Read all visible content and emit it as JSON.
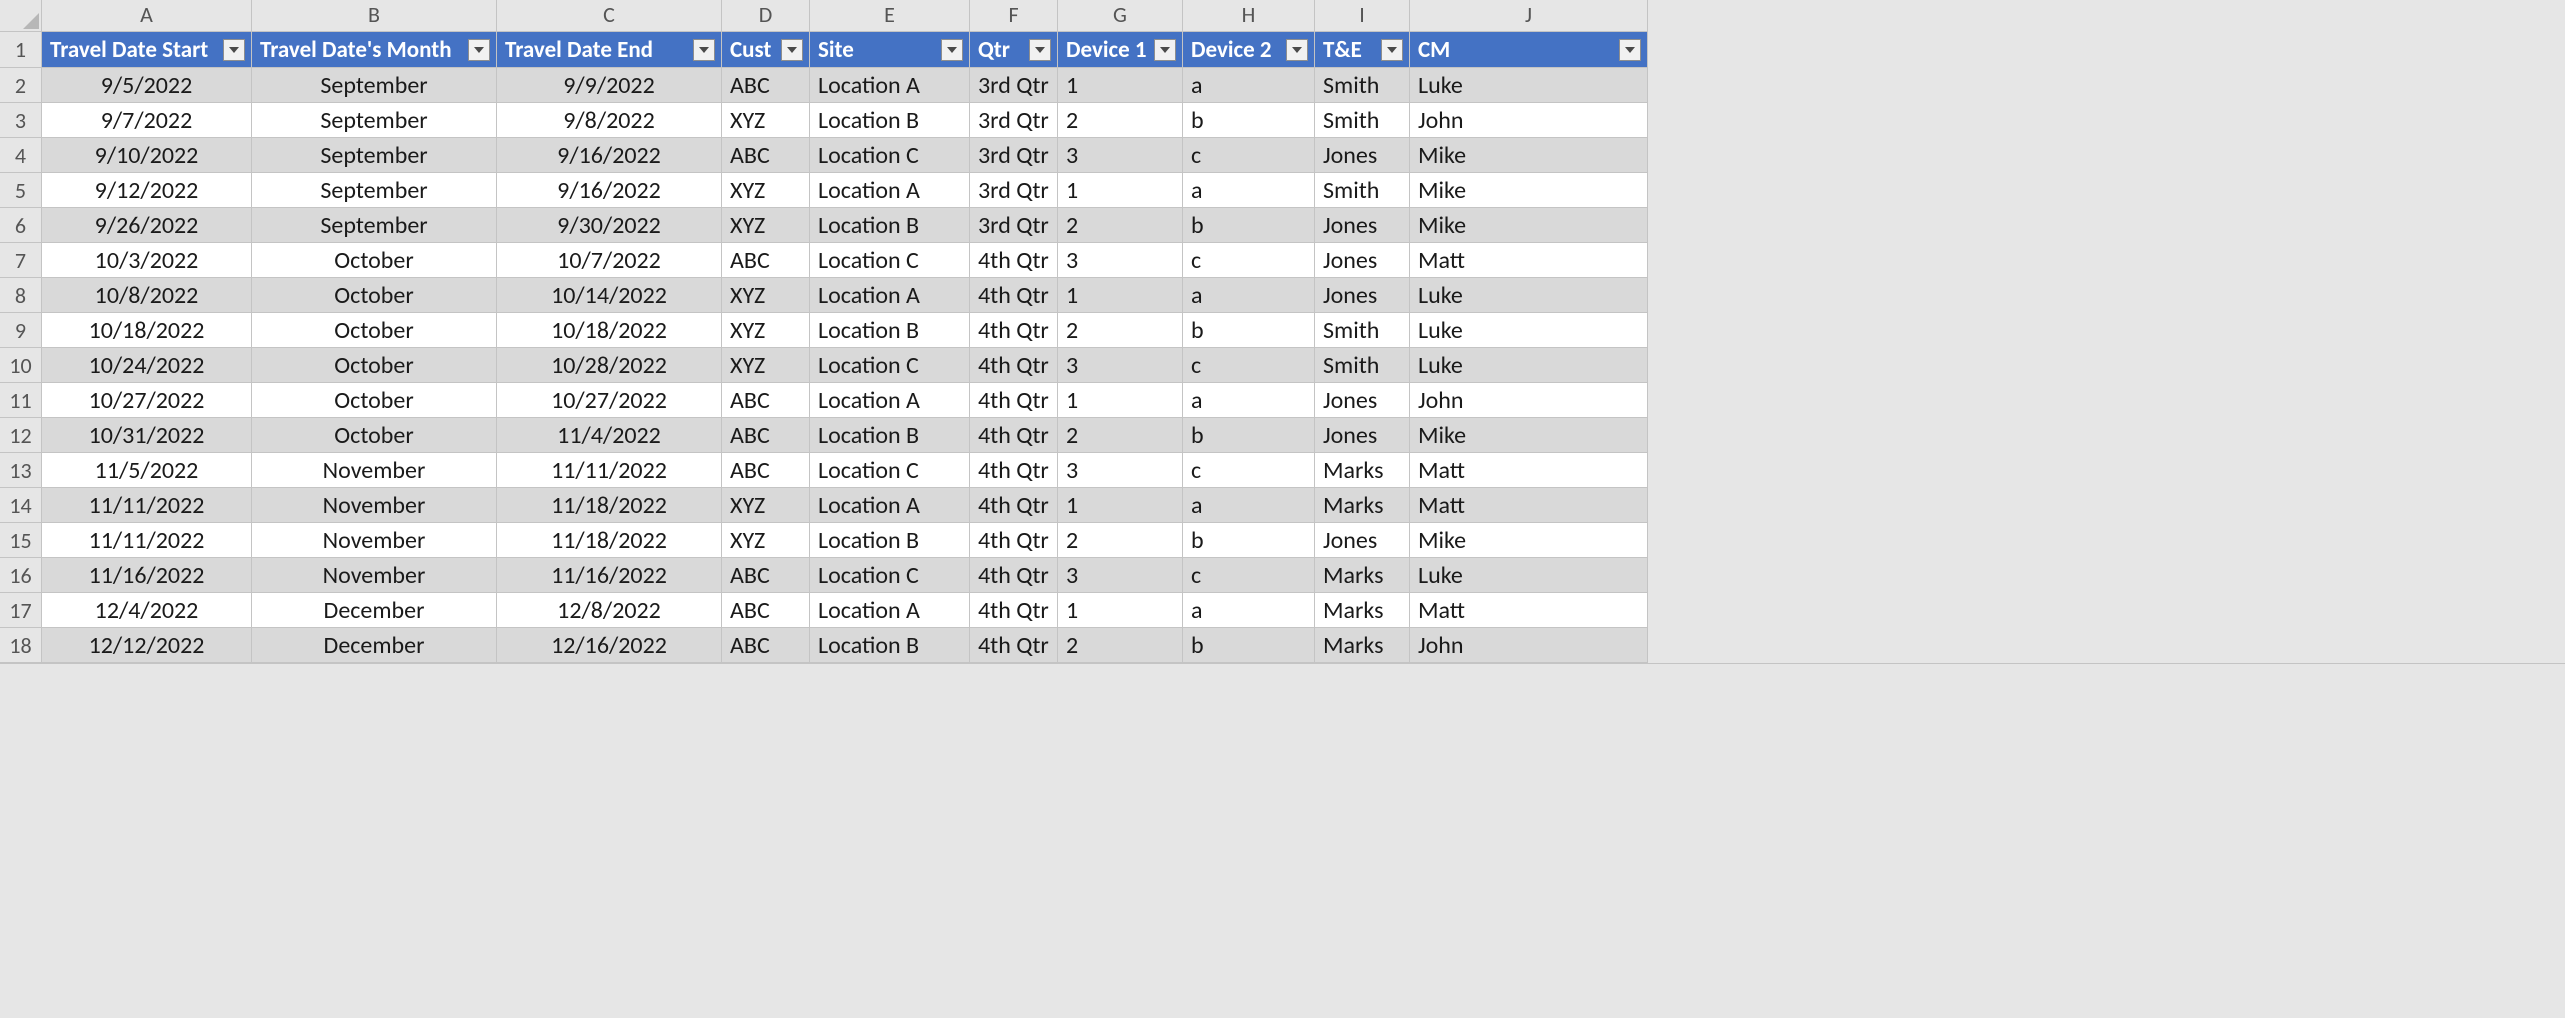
{
  "columns": [
    "A",
    "B",
    "C",
    "D",
    "E",
    "F",
    "G",
    "H",
    "I",
    "J"
  ],
  "header_row_number": "1",
  "headers": [
    "Travel Date Start",
    "Travel Date's Month",
    "Travel Date End",
    "Cust",
    "Site",
    "Qtr",
    "Device 1",
    "Device 2",
    "T&E",
    "CM"
  ],
  "col_align": [
    "center",
    "center",
    "center",
    "left",
    "left",
    "left",
    "left",
    "left",
    "left",
    "left"
  ],
  "row_numbers": [
    "2",
    "3",
    "4",
    "5",
    "6",
    "7",
    "8",
    "9",
    "10",
    "11",
    "12",
    "13",
    "14",
    "15",
    "16",
    "17",
    "18"
  ],
  "rows": [
    [
      "9/5/2022",
      "September",
      "9/9/2022",
      "ABC",
      "Location A",
      "3rd Qtr",
      "1",
      "a",
      "Smith",
      "Luke"
    ],
    [
      "9/7/2022",
      "September",
      "9/8/2022",
      "XYZ",
      "Location B",
      "3rd Qtr",
      "2",
      "b",
      "Smith",
      "John"
    ],
    [
      "9/10/2022",
      "September",
      "9/16/2022",
      "ABC",
      "Location C",
      "3rd Qtr",
      "3",
      "c",
      "Jones",
      "Mike"
    ],
    [
      "9/12/2022",
      "September",
      "9/16/2022",
      "XYZ",
      "Location A",
      "3rd Qtr",
      "1",
      "a",
      "Smith",
      "Mike"
    ],
    [
      "9/26/2022",
      "September",
      "9/30/2022",
      "XYZ",
      "Location B",
      "3rd Qtr",
      "2",
      "b",
      "Jones",
      "Mike"
    ],
    [
      "10/3/2022",
      "October",
      "10/7/2022",
      "ABC",
      "Location C",
      "4th Qtr",
      "3",
      "c",
      "Jones",
      "Matt"
    ],
    [
      "10/8/2022",
      "October",
      "10/14/2022",
      "XYZ",
      "Location A",
      "4th Qtr",
      "1",
      "a",
      "Jones",
      "Luke"
    ],
    [
      "10/18/2022",
      "October",
      "10/18/2022",
      "XYZ",
      "Location B",
      "4th Qtr",
      "2",
      "b",
      "Smith",
      "Luke"
    ],
    [
      "10/24/2022",
      "October",
      "10/28/2022",
      "XYZ",
      "Location C",
      "4th Qtr",
      "3",
      "c",
      "Smith",
      "Luke"
    ],
    [
      "10/27/2022",
      "October",
      "10/27/2022",
      "ABC",
      "Location A",
      "4th Qtr",
      "1",
      "a",
      "Jones",
      "John"
    ],
    [
      "10/31/2022",
      "October",
      "11/4/2022",
      "ABC",
      "Location B",
      "4th Qtr",
      "2",
      "b",
      "Jones",
      "Mike"
    ],
    [
      "11/5/2022",
      "November",
      "11/11/2022",
      "ABC",
      "Location C",
      "4th Qtr",
      "3",
      "c",
      "Marks",
      "Matt"
    ],
    [
      "11/11/2022",
      "November",
      "11/18/2022",
      "XYZ",
      "Location A",
      "4th Qtr",
      "1",
      "a",
      "Marks",
      "Matt"
    ],
    [
      "11/11/2022",
      "November",
      "11/18/2022",
      "XYZ",
      "Location B",
      "4th Qtr",
      "2",
      "b",
      "Jones",
      "Mike"
    ],
    [
      "11/16/2022",
      "November",
      "11/16/2022",
      "ABC",
      "Location C",
      "4th Qtr",
      "3",
      "c",
      "Marks",
      "Luke"
    ],
    [
      "12/4/2022",
      "December",
      "12/8/2022",
      "ABC",
      "Location A",
      "4th Qtr",
      "1",
      "a",
      "Marks",
      "Matt"
    ],
    [
      "12/12/2022",
      "December",
      "12/16/2022",
      "ABC",
      "Location B",
      "4th Qtr",
      "2",
      "b",
      "Marks",
      "John"
    ]
  ]
}
